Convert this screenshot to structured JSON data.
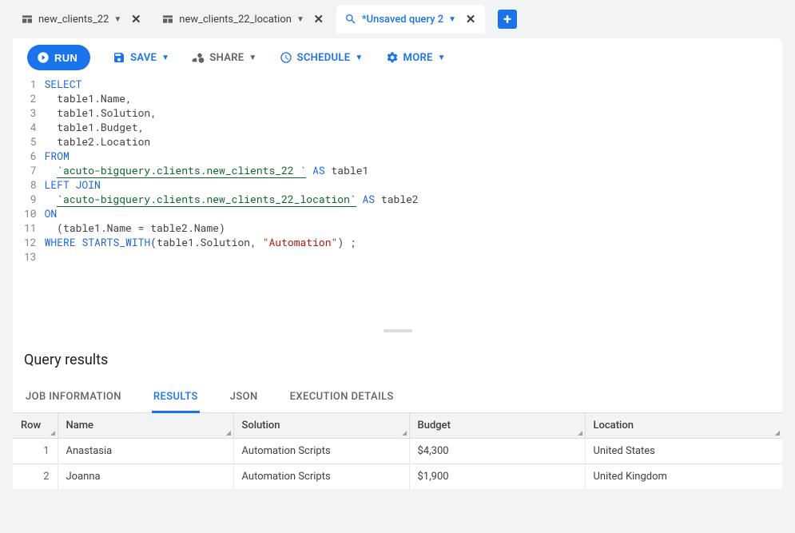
{
  "tabs": [
    {
      "label": "new_clients_22",
      "type": "table"
    },
    {
      "label": "new_clients_22_location",
      "type": "table"
    },
    {
      "label": "*Unsaved query 2",
      "type": "query",
      "active": true
    }
  ],
  "toolbar": {
    "run": "RUN",
    "save": "SAVE",
    "share": "SHARE",
    "schedule": "SCHEDULE",
    "more": "MORE"
  },
  "editor": {
    "lines": [
      [
        {
          "t": "SELECT",
          "c": "kw"
        }
      ],
      [
        {
          "t": "  table1.Name,"
        }
      ],
      [
        {
          "t": "  table1.Solution,"
        }
      ],
      [
        {
          "t": "  table1.Budget,"
        }
      ],
      [
        {
          "t": "  table2.Location"
        }
      ],
      [
        {
          "t": "FROM",
          "c": "kw"
        }
      ],
      [
        {
          "t": "  "
        },
        {
          "t": "`acuto-bigquery.clients.new_clients_22 `",
          "c": "tbl"
        },
        {
          "t": " "
        },
        {
          "t": "AS",
          "c": "kw"
        },
        {
          "t": " table1"
        }
      ],
      [
        {
          "t": "LEFT JOIN",
          "c": "kw"
        }
      ],
      [
        {
          "t": "  "
        },
        {
          "t": "`acuto-bigquery.clients.new_clients_22_location`",
          "c": "tbl"
        },
        {
          "t": " "
        },
        {
          "t": "AS",
          "c": "kw"
        },
        {
          "t": " table2"
        }
      ],
      [
        {
          "t": "ON",
          "c": "kw"
        }
      ],
      [
        {
          "t": "  (table1.Name = table2.Name)"
        }
      ],
      [
        {
          "t": "WHERE",
          "c": "kw"
        },
        {
          "t": " "
        },
        {
          "t": "STARTS_WITH",
          "c": "fn"
        },
        {
          "t": "(table1.Solution, "
        },
        {
          "t": "\"Automation\"",
          "c": "str"
        },
        {
          "t": ") ;"
        }
      ],
      [
        {
          "t": ""
        }
      ]
    ]
  },
  "results": {
    "title": "Query results",
    "tabs": [
      "JOB INFORMATION",
      "RESULTS",
      "JSON",
      "EXECUTION DETAILS"
    ],
    "active_tab": "RESULTS",
    "columns": [
      "Row",
      "Name",
      "Solution",
      "Budget",
      "Location"
    ],
    "rows": [
      {
        "row": 1,
        "Name": "Anastasia",
        "Solution": "Automation Scripts",
        "Budget": "$4,300",
        "Location": "United States"
      },
      {
        "row": 2,
        "Name": "Joanna",
        "Solution": "Automation Scripts",
        "Budget": "$1,900",
        "Location": "United Kingdom"
      }
    ]
  }
}
